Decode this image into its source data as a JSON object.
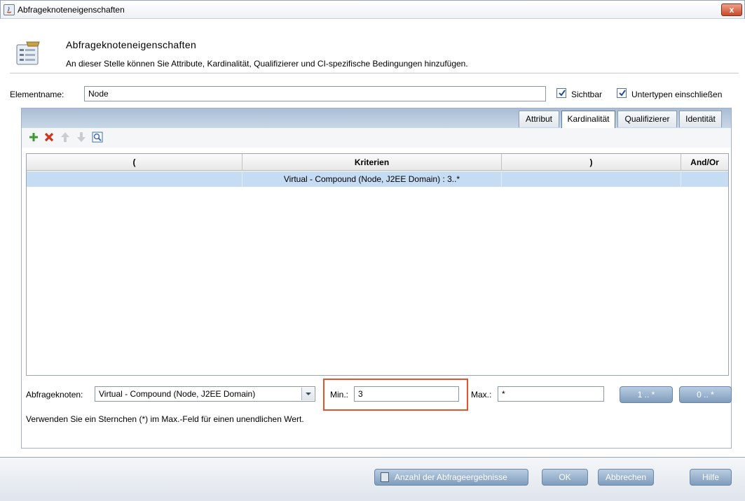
{
  "window": {
    "title": "Abfrageknoteneigenschaften",
    "close_label": "x"
  },
  "header": {
    "title": "Abfrageknoteneigenschaften",
    "description": "An dieser Stelle können Sie Attribute, Kardinalität, Qualifizierer und CI-spezifische Bedingungen hinzufügen."
  },
  "element": {
    "name_label": "Elementname:",
    "name_value": "Node",
    "visible_label": "Sichtbar",
    "visible_checked": true,
    "subtypes_label": "Untertypen einschließen",
    "subtypes_checked": true
  },
  "tabs": [
    {
      "label": "Attribut",
      "active": false
    },
    {
      "label": "Kardinalität",
      "active": true
    },
    {
      "label": "Qualifizierer",
      "active": false
    },
    {
      "label": "Identität",
      "active": false
    }
  ],
  "toolbar": {
    "icons": [
      "add-icon",
      "delete-icon",
      "move-up-icon",
      "move-down-icon",
      "preview-icon"
    ]
  },
  "table": {
    "columns": [
      "(",
      "Kriterien",
      ")",
      "And/Or"
    ],
    "rows": [
      {
        "open": "",
        "criteria": "Virtual - Compound (Node, J2EE Domain) : 3..*",
        "close": "",
        "andor": "",
        "selected": true
      }
    ]
  },
  "cardinality": {
    "node_label": "Abfrageknoten:",
    "node_value": "Virtual - Compound  (Node,  J2EE Domain)",
    "min_label": "Min.:",
    "min_value": "3",
    "max_label": "Max.:",
    "max_value": "*",
    "preset_1": "1 .. *",
    "preset_0": "0 .. *",
    "hint": "Verwenden Sie ein Sternchen (*) im Max.-Feld für einen unendlichen Wert."
  },
  "footer": {
    "count_label": "Anzahl der Abfrageergebnisse",
    "ok_label": "OK",
    "cancel_label": "Abbrechen",
    "help_label": "Hilfe"
  }
}
